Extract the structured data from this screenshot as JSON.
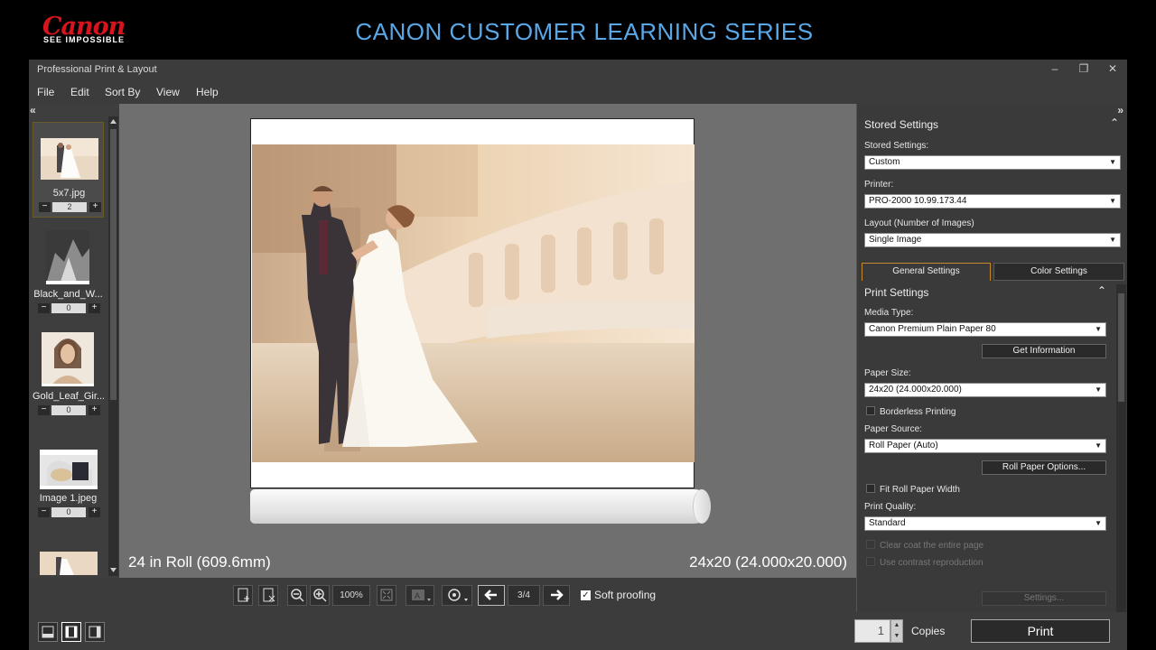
{
  "banner": {
    "logo": "Canon",
    "tagline": "SEE IMPOSSIBLE",
    "title": "CANON CUSTOMER LEARNING SERIES"
  },
  "window": {
    "title": "Professional Print & Layout",
    "minimize": "–",
    "maximize": "❐",
    "close": "✕"
  },
  "menu": [
    "File",
    "Edit",
    "Sort By",
    "View",
    "Help"
  ],
  "thumbnails": [
    {
      "name": "5x7.jpg",
      "count": "2",
      "selected": true
    },
    {
      "name": "Black_and_W...",
      "count": "0"
    },
    {
      "name": "Gold_Leaf_Gir...",
      "count": "0"
    },
    {
      "name": "Image 1.jpeg",
      "count": "0"
    },
    {
      "name": "",
      "count": ""
    }
  ],
  "stepper": {
    "minus": "−",
    "plus": "+"
  },
  "collapse_left": "«",
  "preview": {
    "roll_label": "24 in Roll (609.6mm)",
    "size_label": "24x20 (24.000x20.000)"
  },
  "toolbar": {
    "zoom": "100%",
    "page": "3/4",
    "soft_proofing": "Soft proofing",
    "soft_proofing_checked": "✓",
    "prev": "🡐",
    "next": "🡒"
  },
  "bottom": {
    "copies_value": "1",
    "copies_label": "Copies",
    "print": "Print",
    "spin_up": "▲",
    "spin_down": "▼"
  },
  "panel": {
    "expand": "»",
    "stored_header": "Stored Settings",
    "stored_label": "Stored Settings:",
    "stored_value": "Custom",
    "printer_label": "Printer:",
    "printer_value": "PRO-2000 10.99.173.44",
    "layout_label": "Layout (Number of Images)",
    "layout_value": "Single Image",
    "tab_general": "General Settings",
    "tab_color": "Color Settings",
    "print_header": "Print Settings",
    "media_label": "Media Type:",
    "media_value": "Canon Premium Plain Paper 80",
    "get_info": "Get Information",
    "paper_size_label": "Paper Size:",
    "paper_size_value": "24x20 (24.000x20.000)",
    "borderless": "Borderless Printing",
    "paper_source_label": "Paper Source:",
    "paper_source_value": "Roll Paper (Auto)",
    "roll_options": "Roll Paper Options...",
    "fit_roll": "Fit Roll Paper Width",
    "quality_label": "Print Quality:",
    "quality_value": "Standard",
    "clear_coat": "Clear coat the entire page",
    "contrast": "Use contrast reproduction",
    "settings_btn": "Settings...",
    "collapse": "⌃",
    "dropdown_arrow": "▼"
  },
  "colors": {
    "accent_tab": "#c48a2a",
    "banner_title": "#5aa7e6",
    "canon_red": "#d6141e"
  }
}
